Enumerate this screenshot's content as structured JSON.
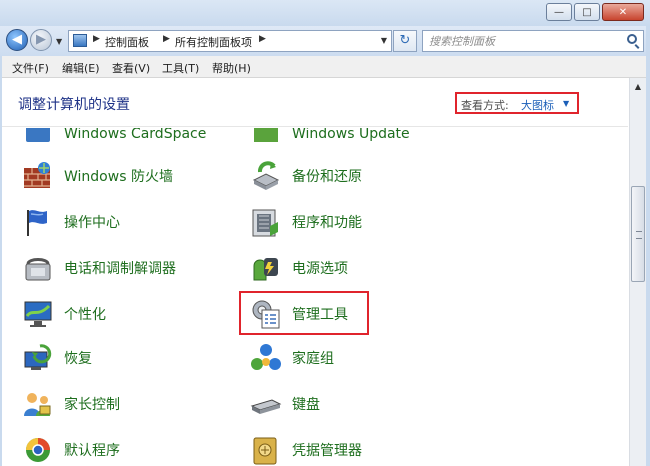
{
  "window": {
    "caption_buttons": {
      "minimize": "—",
      "maximize": "□",
      "close": "✕"
    }
  },
  "nav": {
    "back_icon": "back-arrow-icon",
    "forward_icon": "forward-arrow-icon",
    "breadcrumbs": [
      "控制面板",
      "所有控制面板项"
    ],
    "search_placeholder": "搜索控制面板"
  },
  "menu": [
    "文件(F)",
    "编辑(E)",
    "查看(V)",
    "工具(T)",
    "帮助(H)"
  ],
  "header": {
    "title": "调整计算机的设置",
    "view_label": "查看方式:",
    "view_value": "大图标"
  },
  "items": {
    "cardspace": "Windows CardSpace",
    "update": "Windows Update",
    "firewall": "Windows 防火墙",
    "backup": "备份和还原",
    "action_center": "操作中心",
    "programs": "程序和功能",
    "modem": "电话和调制解调器",
    "power": "电源选项",
    "personalize": "个性化",
    "admin_tools": "管理工具",
    "recovery": "恢复",
    "homegroup": "家庭组",
    "parental": "家长控制",
    "keyboard": "键盘",
    "default_programs": "默认程序",
    "credential": "凭据管理器"
  },
  "colors": {
    "item_text": "#1e6e1e",
    "title_text": "#1e3287",
    "highlight": "#e0242c",
    "link": "#1b5fb8"
  }
}
